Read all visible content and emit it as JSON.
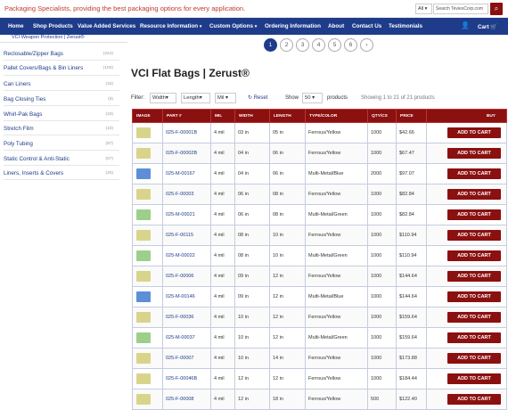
{
  "header": {
    "tagline": "Packaging Specialists, providing the best packaging options for every application.",
    "category_select": "All",
    "search_placeholder": "Search TeviesCorp.com"
  },
  "nav": {
    "items": [
      "Home",
      "Shop Products",
      "Value Added Services",
      "Resource Information",
      "Custom Options",
      "Ordering Information",
      "About",
      "Contact Us",
      "Testimonials"
    ],
    "cart_label": "Cart"
  },
  "breadcrumb": "VCI Weapon Protection | Zerust®",
  "pagination": [
    "1",
    "2",
    "3",
    "4",
    "5",
    "6"
  ],
  "sidebar": [
    {
      "label": "Reclosable/Zipper Bags",
      "count": "(224)"
    },
    {
      "label": "Pallet Covers/Bags & Bin Liners",
      "count": "(100)"
    },
    {
      "label": "Can Liners",
      "count": "(16)"
    },
    {
      "label": "Bag Closing Ties",
      "count": "(9)"
    },
    {
      "label": "Whirl-Pak Bags",
      "count": "(19)"
    },
    {
      "label": "Stretch Film",
      "count": "(10)"
    },
    {
      "label": "Poly Tubing",
      "count": "(87)"
    },
    {
      "label": "Static Control & Anti-Static",
      "count": "(67)"
    },
    {
      "label": "Liners, Inserts & Covers",
      "count": "(20)"
    }
  ],
  "title": "VCI Flat Bags | Zerust®",
  "filters": {
    "filter_label": "Filter:",
    "width": "Width",
    "length": "Length",
    "mil": "Mil",
    "reset": "Reset",
    "show_label": "Show",
    "show_value": "50",
    "products_label": "products",
    "showing": "Showing 1 to 21 of 21 products"
  },
  "table": {
    "headers": [
      "IMAGE",
      "PART #",
      "MIL",
      "WIDTH",
      "LENGTH",
      "TYPE/COLOR",
      "QTY/CS",
      "PRICE",
      "BUY"
    ],
    "button_label": "ADD TO CART",
    "rows": [
      {
        "part": "025-F-00001B",
        "mil": "4 mil",
        "width": "03 in",
        "length": "05 in",
        "type": "Ferrous/Yellow",
        "qty": "1000",
        "price": "$42.66",
        "color": "yellow"
      },
      {
        "part": "025-F-00002B",
        "mil": "4 mil",
        "width": "04 in",
        "length": "06 in",
        "type": "Ferrous/Yellow",
        "qty": "1000",
        "price": "$67.47",
        "color": "yellow"
      },
      {
        "part": "025-M-00167",
        "mil": "4 mil",
        "width": "04 in",
        "length": "06 in",
        "type": "Multi-Metal/Blue",
        "qty": "2000",
        "price": "$97.07",
        "color": "blue"
      },
      {
        "part": "025-F-00003",
        "mil": "4 mil",
        "width": "06 in",
        "length": "08 in",
        "type": "Ferrous/Yellow",
        "qty": "1000",
        "price": "$82.84",
        "color": "yellow"
      },
      {
        "part": "025-M-00021",
        "mil": "4 mil",
        "width": "06 in",
        "length": "08 in",
        "type": "Multi-Metal/Green",
        "qty": "1000",
        "price": "$82.84",
        "color": "green"
      },
      {
        "part": "025-F-00115",
        "mil": "4 mil",
        "width": "08 in",
        "length": "10 in",
        "type": "Ferrous/Yellow",
        "qty": "1000",
        "price": "$110.94",
        "color": "yellow"
      },
      {
        "part": "025-M-00022",
        "mil": "4 mil",
        "width": "08 in",
        "length": "10 in",
        "type": "Multi-Metal/Green",
        "qty": "1000",
        "price": "$110.94",
        "color": "green"
      },
      {
        "part": "025-F-00006",
        "mil": "4 mil",
        "width": "09 in",
        "length": "12 in",
        "type": "Ferrous/Yellow",
        "qty": "1000",
        "price": "$144.64",
        "color": "yellow"
      },
      {
        "part": "025-M-00146",
        "mil": "4 mil",
        "width": "09 in",
        "length": "12 in",
        "type": "Multi-Metal/Blue",
        "qty": "1000",
        "price": "$144.64",
        "color": "blue"
      },
      {
        "part": "025-F-00036",
        "mil": "4 mil",
        "width": "10 in",
        "length": "12 in",
        "type": "Ferrous/Yellow",
        "qty": "1000",
        "price": "$159.64",
        "color": "yellow"
      },
      {
        "part": "025-M-00037",
        "mil": "4 mil",
        "width": "10 in",
        "length": "12 in",
        "type": "Multi-Metal/Green",
        "qty": "1000",
        "price": "$159.64",
        "color": "green"
      },
      {
        "part": "025-F-00007",
        "mil": "4 mil",
        "width": "10 in",
        "length": "14 in",
        "type": "Ferrous/Yellow",
        "qty": "1000",
        "price": "$173.88",
        "color": "yellow"
      },
      {
        "part": "025-F-00046B",
        "mil": "4 mil",
        "width": "12 in",
        "length": "12 in",
        "type": "Ferrous/Yellow",
        "qty": "1000",
        "price": "$184.44",
        "color": "yellow"
      },
      {
        "part": "025-F-00008",
        "mil": "4 mil",
        "width": "12 in",
        "length": "18 in",
        "type": "Ferrous/Yellow",
        "qty": "500",
        "price": "$122.40",
        "color": "yellow"
      }
    ]
  },
  "colors": {
    "accent": "#8b1010",
    "nav": "#1e3c8a",
    "yellow": "#d9d48c",
    "green": "#9ccf8a",
    "blue": "#5c8fd6"
  }
}
